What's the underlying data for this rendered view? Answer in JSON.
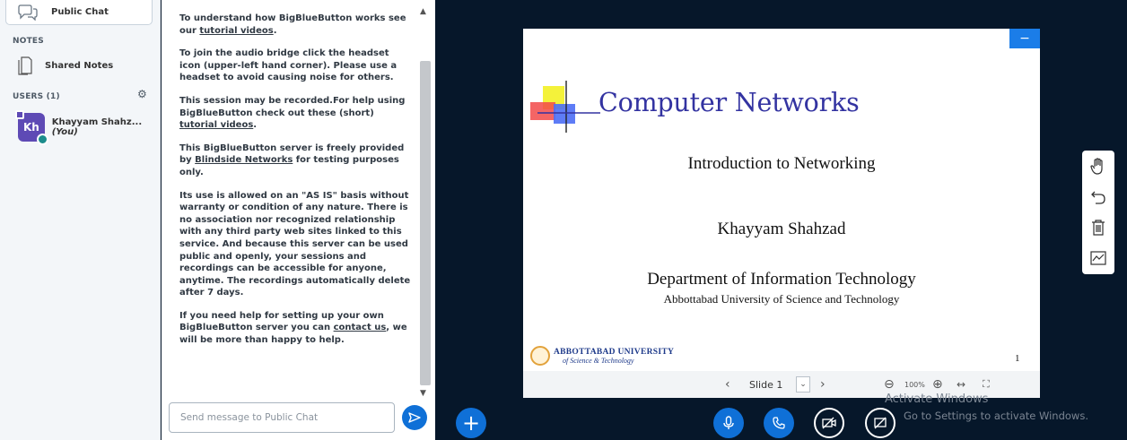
{
  "userlist": {
    "public_chat_label": "Public Chat",
    "notes_header": "NOTES",
    "shared_notes_label": "Shared Notes",
    "users_header": "USERS (1)",
    "user": {
      "initials": "Kh",
      "name": "Khayyam Shahz...",
      "you_tag": "(You)"
    }
  },
  "chat": {
    "p1_text": "To understand how BigBlueButton works see our ",
    "p1_link": "tutorial videos",
    "p1_end": ".",
    "p2": "To join the audio bridge click the headset icon (upper-left hand corner). Please use a headset to avoid causing noise for others.",
    "p3_text": "This session may be recorded.For help using BigBlueButton check out these (short) ",
    "p3_link": "tutorial videos",
    "p3_end": ".",
    "p4_text": "This BigBlueButton server is freely provided by ",
    "p4_link": "Blindside Networks",
    "p4_end": " for testing purposes only.",
    "p5": "Its use is allowed on an \"AS IS\" basis without warranty or condition of any nature. There is no association nor recognized relationship with any third party web sites linked to this service. And because this server can be used public and openly, your sessions and recordings can be accessible for anyone, anytime. The recordings automatically delete after 7 days.",
    "p6_text": "If you need help for setting up your own BigBlueButton server you can ",
    "p6_link": "contact us",
    "p6_end": ", we will be more than happy to help.",
    "input_placeholder": "Send message to Public Chat"
  },
  "slide": {
    "title": "Computer Networks",
    "subtitle": "Introduction to Networking",
    "author": "Khayyam Shahzad",
    "department": "Department of Information Technology",
    "university": "Abbottabad University of Science and Technology",
    "logo_line1": "ABBOTTABAD UNIVERSITY",
    "logo_line2": "of Science & Technology",
    "page_number": "1"
  },
  "controls": {
    "slide_label": "Slide 1",
    "zoom_level": "100%"
  },
  "watermark": {
    "line1": "Activate Windows",
    "line2": "Go to Settings to activate Windows."
  },
  "colors": {
    "accent": "#0f70d7",
    "background": "#06172a",
    "slide_title": "#3333a1"
  }
}
